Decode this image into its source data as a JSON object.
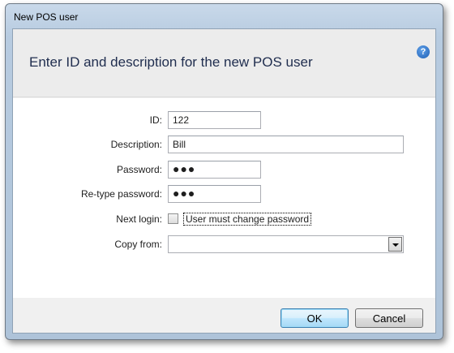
{
  "window": {
    "title": "New POS user"
  },
  "header": {
    "title": "Enter ID and description for the new POS user",
    "help_icon": "help-icon"
  },
  "form": {
    "id": {
      "label": "ID:",
      "value": "122"
    },
    "description": {
      "label": "Description:",
      "value": "Bill"
    },
    "password": {
      "label": "Password:",
      "value": "●●●"
    },
    "retype_password": {
      "label": "Re-type password:",
      "value": "●●●"
    },
    "next_login": {
      "label": "Next login:",
      "checkbox_label": "User must change password",
      "checked": false
    },
    "copy_from": {
      "label": "Copy from:",
      "value": ""
    }
  },
  "buttons": {
    "ok_label": "OK",
    "cancel_label": "Cancel"
  },
  "colors": {
    "accent": "#1f5fb5",
    "header_text": "#1f2d4e",
    "window_frame": "#b7cbe0"
  }
}
